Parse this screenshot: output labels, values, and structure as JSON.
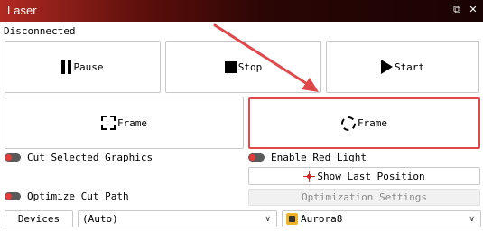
{
  "window": {
    "title": "Laser",
    "restore_icon": "restore-icon",
    "close_icon": "close-icon"
  },
  "status_text": "Disconnected",
  "buttons": {
    "pause": "Pause",
    "stop": "Stop",
    "start": "Start",
    "frame_left": "Frame",
    "frame_right": "Frame"
  },
  "toggles": {
    "cut_selected": "Cut Selected Graphics",
    "enable_red_light": "Enable Red Light",
    "optimize_cut_path": "Optimize Cut Path"
  },
  "show_last_position": "Show Last Position",
  "optimization_settings": "Optimization Settings",
  "devices_button": "Devices",
  "port_select": {
    "value": "(Auto)"
  },
  "device_select": {
    "value": "Aurora8"
  },
  "colors": {
    "highlight": "#e0484c",
    "toggle_dot": "#e53a3a",
    "arrow": "#e0484c"
  }
}
